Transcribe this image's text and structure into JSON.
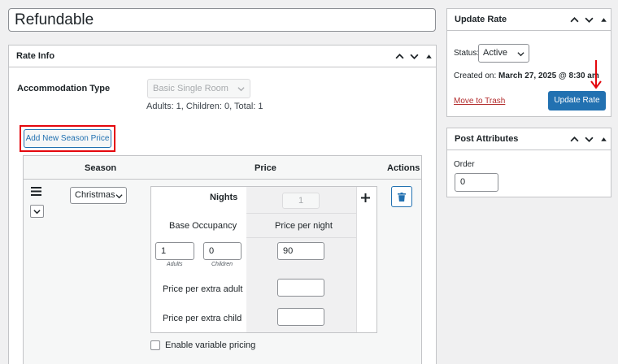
{
  "post_title": "Refundable",
  "rate_info": {
    "title": "Rate Info",
    "accommodation_type_label": "Accommodation Type",
    "accommodation_type_value": "Basic Single Room",
    "occupancy_text": "Adults: 1, Children: 0, Total: 1",
    "add_season_button": "Add New Season Price",
    "table": {
      "columns": [
        "Season",
        "Price",
        "Actions"
      ],
      "row": {
        "season": "Christmas",
        "nights_label": "Nights",
        "nights_value": "1",
        "base_occupancy_label": "Base Occupancy",
        "price_per_night_label": "Price per night",
        "adults_value": "1",
        "adults_caption": "Adults",
        "children_value": "0",
        "children_caption": "Children",
        "price_per_night_value": "90",
        "extra_adult_label": "Price per extra adult",
        "extra_adult_value": "",
        "extra_child_label": "Price per extra child",
        "extra_child_value": ""
      }
    },
    "variable_pricing_label": "Enable variable pricing",
    "variable_pricing_checked": false
  },
  "update_rate": {
    "title": "Update Rate",
    "status_label": "Status:",
    "status_value": "Active",
    "created_label": "Created on:",
    "created_value": "March 27, 2025 @ 8:30 am",
    "trash_link": "Move to Trash",
    "update_button": "Update Rate"
  },
  "post_attributes": {
    "title": "Post Attributes",
    "order_label": "Order",
    "order_value": "0"
  },
  "colors": {
    "primary": "#2271b1",
    "highlight": "#e4070d",
    "danger": "#b32d2e",
    "background": "#f0f0f1"
  },
  "icons": [
    "chevron-up-icon",
    "chevron-down-icon",
    "caret-up-icon",
    "drag-handle-icon",
    "plus-icon",
    "trash-icon",
    "arrow-down-icon"
  ]
}
